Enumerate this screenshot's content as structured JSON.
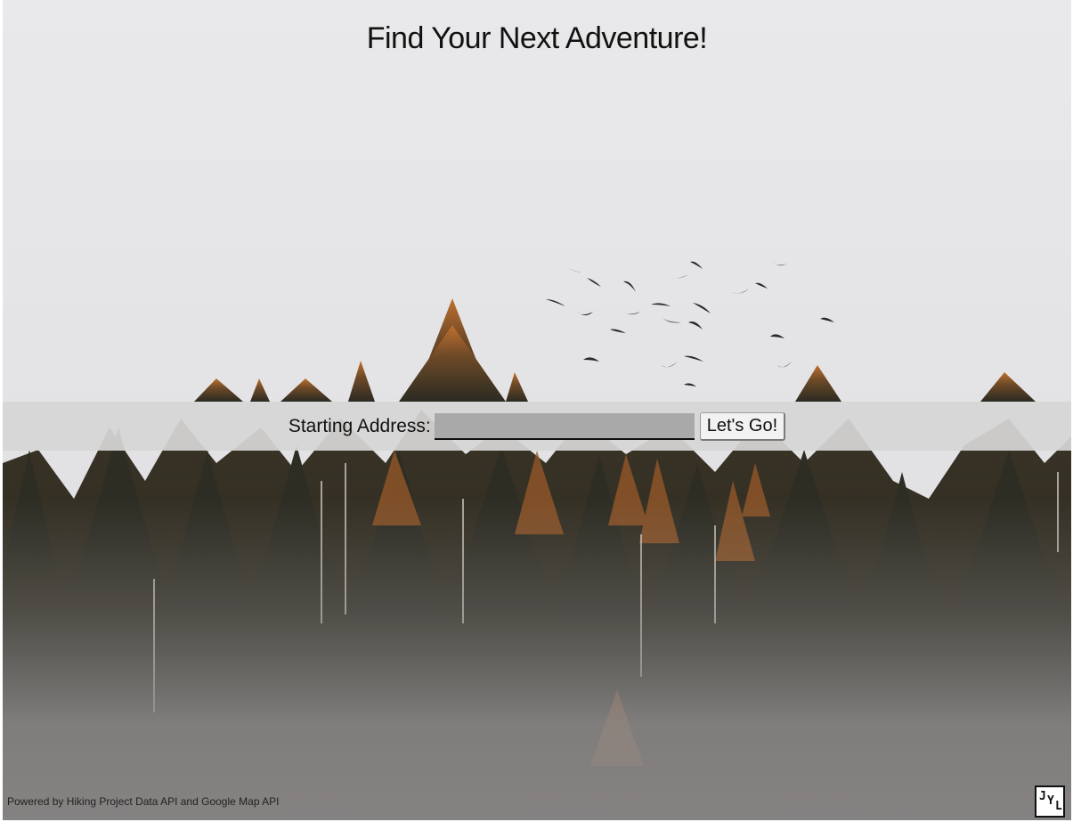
{
  "page": {
    "title": "Find Your Next Adventure!"
  },
  "search": {
    "label": "Starting Address:",
    "value": "",
    "button_label": "Let's Go!"
  },
  "footer": {
    "credit": "Powered by Hiking Project Data API and Google Map API",
    "logo_text": "JYL"
  },
  "background": {
    "description_icon": "forest-with-birds-photo",
    "sky_color": "#e6e5e7",
    "tree_color": "#2f2a22",
    "tree_highlight_color": "#b0622a",
    "fog_color": "#8f8c8c"
  }
}
